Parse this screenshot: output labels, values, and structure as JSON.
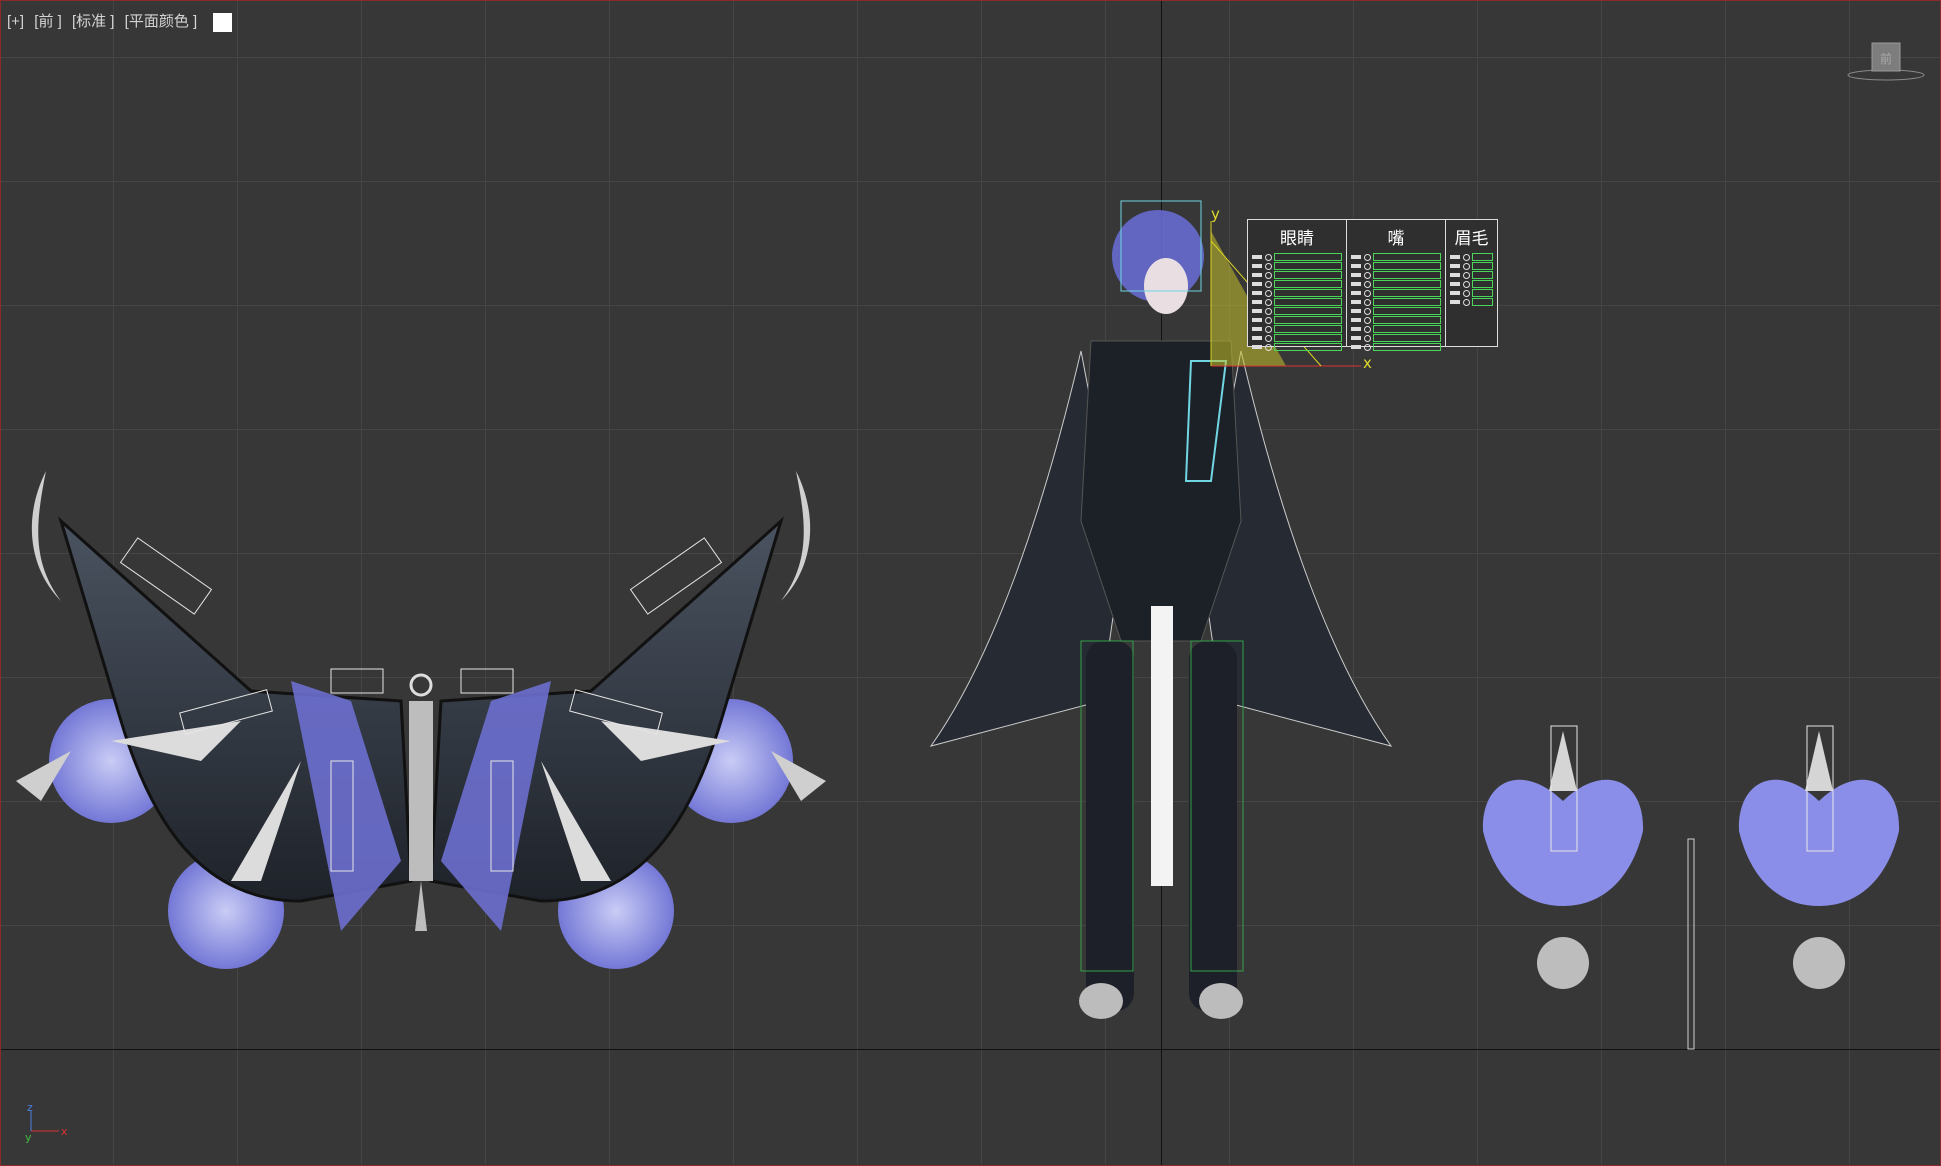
{
  "viewport": {
    "label_parts": [
      "[+]",
      "[前 ]",
      "[标准 ]",
      "[平面颜色 ]"
    ],
    "swatch_color": "#ffffff",
    "viewcube_face": "前"
  },
  "control_panel": {
    "columns": [
      {
        "title": "眼睛",
        "rows": 11
      },
      {
        "title": "嘴",
        "rows": 11
      },
      {
        "title": "眉毛",
        "rows": 6
      }
    ]
  },
  "gizmo": {
    "x_label": "x",
    "y_label": "y"
  },
  "triad": {
    "z_label": "z",
    "y_label": "y",
    "x_label": "x"
  },
  "colors": {
    "background": "#373737",
    "grid": "#454545",
    "accent_purple": "#8a8ee8",
    "control_green": "#4bd35a",
    "gizmo_yellow": "#c7c22a"
  }
}
